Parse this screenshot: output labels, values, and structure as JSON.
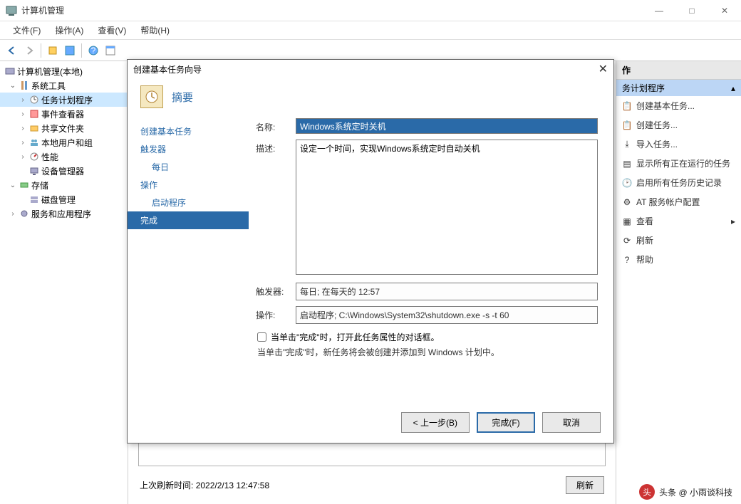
{
  "window": {
    "title": "计算机管理"
  },
  "menu": {
    "file": "文件(F)",
    "action": "操作(A)",
    "view": "查看(V)",
    "help": "帮助(H)"
  },
  "tree": {
    "root": "计算机管理(本地)",
    "sys_tools": "系统工具",
    "task_sched": "任务计划程序",
    "event_viewer": "事件查看器",
    "shared": "共享文件夹",
    "users": "本地用户和组",
    "perf": "性能",
    "device": "设备管理器",
    "storage": "存储",
    "disk": "磁盘管理",
    "services": "服务和应用程序"
  },
  "dialog": {
    "title": "创建基本任务向导",
    "summary": "摘要",
    "nav": {
      "create": "创建基本任务",
      "trigger": "触发器",
      "daily": "每日",
      "action": "操作",
      "startprog": "启动程序",
      "finish": "完成"
    },
    "labels": {
      "name": "名称:",
      "desc": "描述:",
      "trigger": "触发器:",
      "action": "操作:"
    },
    "name_value": "Windows系统定时关机",
    "desc_value": "设定一个时间，实现Windows系统定时自动关机",
    "trigger_value": "每日; 在每天的 12:57",
    "action_value": "启动程序; C:\\Windows\\System32\\shutdown.exe -s -t 60",
    "checkbox": "当单击\"完成\"时，打开此任务属性的对话框。",
    "note": "当单击\"完成\"时，新任务将会被创建并添加到 Windows 计划中。",
    "buttons": {
      "back": "< 上一步(B)",
      "finish": "完成(F)",
      "cancel": "取消"
    }
  },
  "center": {
    "last_refresh_label": "上次刷新时间:",
    "last_refresh_value": "2022/2/13 12:47:58",
    "refresh_btn": "刷新"
  },
  "actions": {
    "header": "作",
    "group": "务计划程序",
    "create_basic": "创建基本任务...",
    "create": "创建任务...",
    "import": "导入任务...",
    "show_running": "显示所有正在运行的任务",
    "enable_history": "启用所有任务历史记录",
    "at_service": "AT 服务帐户配置",
    "view": "查看",
    "refresh": "刷新",
    "help": "帮助"
  },
  "watermark": "头条 @ 小雨谈科技"
}
